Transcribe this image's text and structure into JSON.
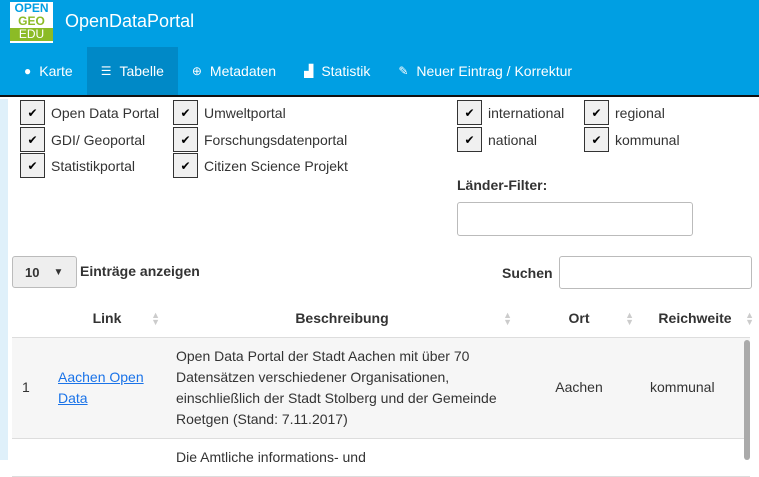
{
  "app": {
    "title": "OpenDataPortal",
    "logo": [
      "OPEN",
      "GEO",
      "EDU"
    ]
  },
  "nav": [
    {
      "label": "Karte",
      "icon": "globe-icon"
    },
    {
      "label": "Tabelle",
      "icon": "list-icon"
    },
    {
      "label": "Metadaten",
      "icon": "download-icon"
    },
    {
      "label": "Statistik",
      "icon": "bar-chart-icon"
    },
    {
      "label": "Neuer Eintrag / Korrektur",
      "icon": "edit-icon"
    }
  ],
  "filters": {
    "types": [
      "Open Data Portal",
      "GDI/ Geoportal",
      "Statistikportal",
      "Umweltportal",
      "Forschungsdatenportal",
      "Citizen Science Projekt"
    ],
    "scope": [
      "international",
      "national",
      "regional",
      "kommunal"
    ],
    "country_label": "Länder-Filter:",
    "country_value": ""
  },
  "length": {
    "value": "10",
    "label": "Einträge anzeigen"
  },
  "search": {
    "label": "Suchen",
    "value": ""
  },
  "table": {
    "headers": [
      "",
      "Link",
      "Beschreibung",
      "Ort",
      "Reichweite"
    ],
    "rows": [
      {
        "n": "1",
        "link": "Aachen Open Data",
        "desc": "Open Data Portal der Stadt Aachen mit über 70 Datensätzen verschiedener Organisationen, einschließlich der Stadt Stolberg und der Gemeinde Roetgen (Stand: 7.11.2017)",
        "ort": "Aachen",
        "reach": "kommunal"
      },
      {
        "n": "",
        "link": "",
        "desc": "Die Amtliche informations- und",
        "ort": "",
        "reach": ""
      }
    ]
  }
}
